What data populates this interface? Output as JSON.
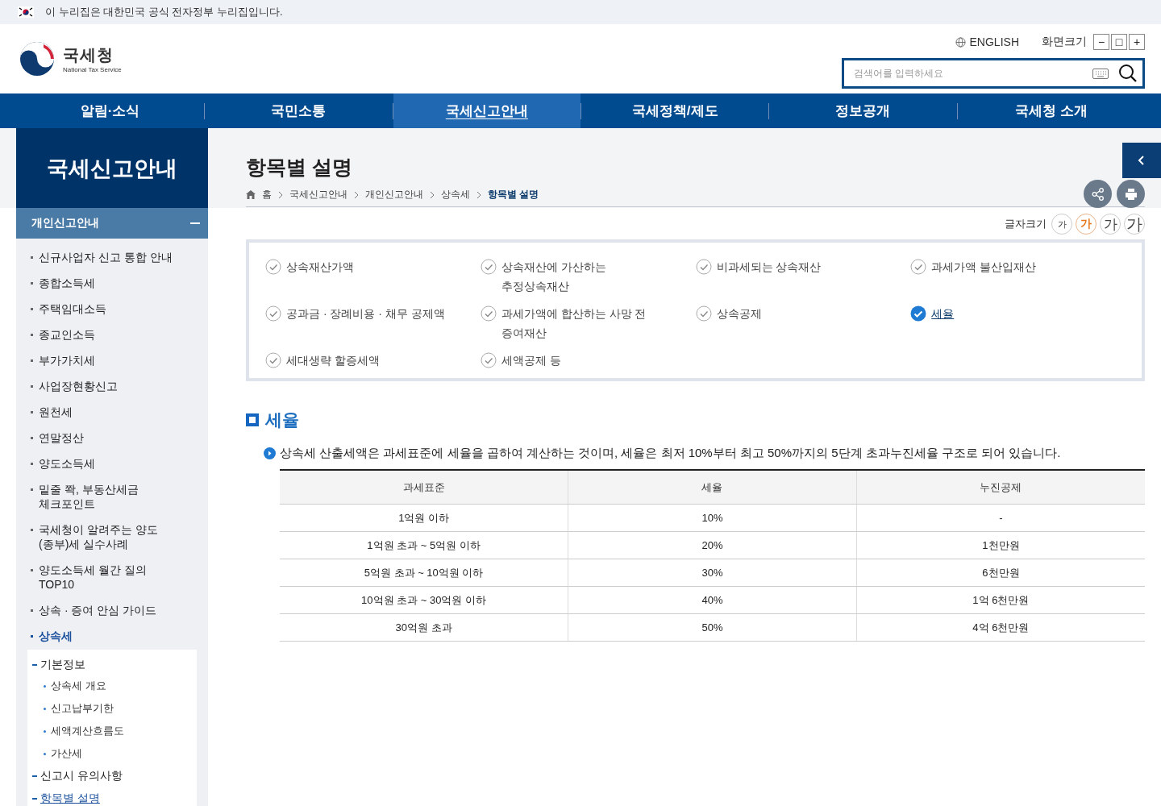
{
  "gov_banner": {
    "text": "이 누리집은 대한민국 공식 전자정부 누리집입니다."
  },
  "header": {
    "logo_name": "국세청",
    "logo_subtitle": "National Tax Service",
    "english_link": "ENGLISH",
    "zoom_label": "화면크기",
    "zoom_buttons": [
      "−",
      "□",
      "+"
    ],
    "search": {
      "placeholder": "검색어를 입력하세요"
    }
  },
  "nav": [
    {
      "label": "알림·소식",
      "selected": false
    },
    {
      "label": "국민소통",
      "selected": false
    },
    {
      "label": "국세신고안내",
      "selected": true
    },
    {
      "label": "국세정책/제도",
      "selected": false
    },
    {
      "label": "정보공개",
      "selected": false
    },
    {
      "label": "국세청 소개",
      "selected": false
    }
  ],
  "sidebar": {
    "title": "국세신고안내",
    "section": {
      "label": "개인신고안내",
      "expanded": true
    },
    "items": [
      {
        "label": "신규사업자 신고 통합 안내",
        "selected": false
      },
      {
        "label": "종합소득세",
        "selected": false
      },
      {
        "label": "주택임대소득",
        "selected": false
      },
      {
        "label": "종교인소득",
        "selected": false
      },
      {
        "label": "부가가치세",
        "selected": false
      },
      {
        "label": "사업장현황신고",
        "selected": false
      },
      {
        "label": "원천세",
        "selected": false
      },
      {
        "label": "연말정산",
        "selected": false
      },
      {
        "label": "양도소득세",
        "selected": false
      },
      {
        "label": "밑줄 쫙, 부동산세금\n체크포인트",
        "selected": false
      },
      {
        "label": "국세청이 알려주는 양도\n(종부)세 실수사례",
        "selected": false
      },
      {
        "label": "양도소득세 월간 질의\nTOP10",
        "selected": false
      },
      {
        "label": "상속 · 증여 안심 가이드",
        "selected": false
      },
      {
        "label": "상속세",
        "selected": true,
        "children": [
          {
            "label": "기본정보",
            "selected": false,
            "children": [
              {
                "label": "상속세 개요",
                "selected": false
              },
              {
                "label": "신고납부기한",
                "selected": false
              },
              {
                "label": "세액계산흐름도",
                "selected": false
              },
              {
                "label": "가산세",
                "selected": false
              }
            ]
          },
          {
            "label": "신고시 유의사항",
            "selected": false
          },
          {
            "label": "항목별 설명",
            "selected": true
          }
        ]
      }
    ]
  },
  "page": {
    "title": "항목별 설명",
    "breadcrumb": [
      "홈",
      "국세신고안내",
      "개인신고안내",
      "상속세",
      "항목별 설명"
    ],
    "font_size": {
      "label": "글자크기",
      "options": [
        {
          "label": "가",
          "selected": false
        },
        {
          "label": "가",
          "selected": true
        },
        {
          "label": "가",
          "selected": false
        },
        {
          "label": "가",
          "selected": false
        }
      ]
    },
    "index": [
      {
        "label": "상속재산가액",
        "selected": false
      },
      {
        "label": "상속재산에 가산하는\n추정상속재산",
        "selected": false
      },
      {
        "label": "비과세되는 상속재산",
        "selected": false
      },
      {
        "label": "과세가액 불산입재산",
        "selected": false
      },
      {
        "label": "공과금 · 장례비용 · 채무 공제액",
        "selected": false
      },
      {
        "label": "과세가액에 합산하는 사망 전\n증여재산",
        "selected": false
      },
      {
        "label": "상속공제",
        "selected": false
      },
      {
        "label": "세율",
        "selected": true
      },
      {
        "label": "세대생략 할증세액",
        "selected": false
      },
      {
        "label": "세액공제 등",
        "selected": false
      }
    ],
    "section": {
      "heading": "세율",
      "note": "상속세 산출세액은 과세표준에 세율을 곱하여 계산하는 것이며, 세율은 최저 10%부터 최고 50%까지의 5단계 초과누진세율 구조로 되어 있습니다.",
      "table": {
        "columns": [
          "과세표준",
          "세율",
          "누진공제"
        ],
        "rows": [
          [
            "1억원 이하",
            "10%",
            "-"
          ],
          [
            "1억원 초과 ~ 5억원 이하",
            "20%",
            "1천만원"
          ],
          [
            "5억원 초과 ~ 10억원 이하",
            "30%",
            "6천만원"
          ],
          [
            "10억원 초과 ~ 30억원 이하",
            "40%",
            "1억 6천만원"
          ],
          [
            "30억원 초과",
            "50%",
            "4억 6천만원"
          ]
        ]
      }
    }
  }
}
